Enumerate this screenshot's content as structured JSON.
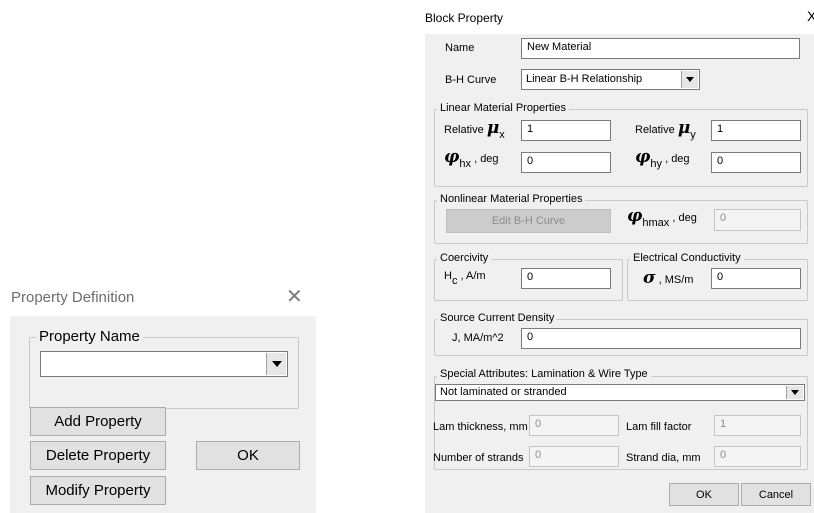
{
  "property_definition": {
    "title": "Property Definition",
    "close_glyph": "✕",
    "group_label": "Property Name",
    "property_name_value": "",
    "buttons": {
      "add": "Add Property",
      "delete": "Delete Property",
      "modify": "Modify Property",
      "ok": "OK"
    }
  },
  "block_property": {
    "title": "Block Property",
    "close_glyph": "X",
    "name_label": "Name",
    "name_value": "New Material",
    "bh_label": "B-H Curve",
    "bh_value": "Linear B-H Relationship",
    "linear": {
      "group_label": "Linear Material Properties",
      "relative_label": "Relative",
      "mu_glyph": "μ",
      "x_sub": "x",
      "y_sub": "y",
      "mu_x_value": "1",
      "mu_y_value": "1",
      "phi_glyph": "φ",
      "hx_sub": "hx",
      "hy_sub": "hy",
      "deg_suffix": ", deg",
      "phi_hx_value": "0",
      "phi_hy_value": "0"
    },
    "nonlinear": {
      "group_label": "Nonlinear Material Properties",
      "edit_button": "Edit B-H Curve",
      "phi_glyph": "φ",
      "hmax_sub": "hmax",
      "deg_suffix": ", deg",
      "phi_hmax_value": "0"
    },
    "coercivity": {
      "group_label": "Coercivity",
      "h_label": "H",
      "c_sub": "c",
      "unit": ", A/m",
      "value": "0"
    },
    "conductivity": {
      "group_label": "Electrical Conductivity",
      "sigma_glyph": "σ",
      "unit": ", MS/m",
      "value": "0"
    },
    "current": {
      "group_label": "Source Current Density",
      "label": "J, MA/m^2",
      "value": "0"
    },
    "special": {
      "group_label": "Special Attributes:  Lamination & Wire Type",
      "lam_type_value": "Not laminated or stranded",
      "lam_thickness_label": "Lam thickness, mm",
      "lam_thickness_value": "0",
      "lam_fill_label": "Lam fill factor",
      "lam_fill_value": "1",
      "strands_label": "Number of strands",
      "strands_value": "0",
      "strand_dia_label": "Strand dia, mm",
      "strand_dia_value": "0"
    },
    "buttons": {
      "ok": "OK",
      "cancel": "Cancel"
    }
  }
}
